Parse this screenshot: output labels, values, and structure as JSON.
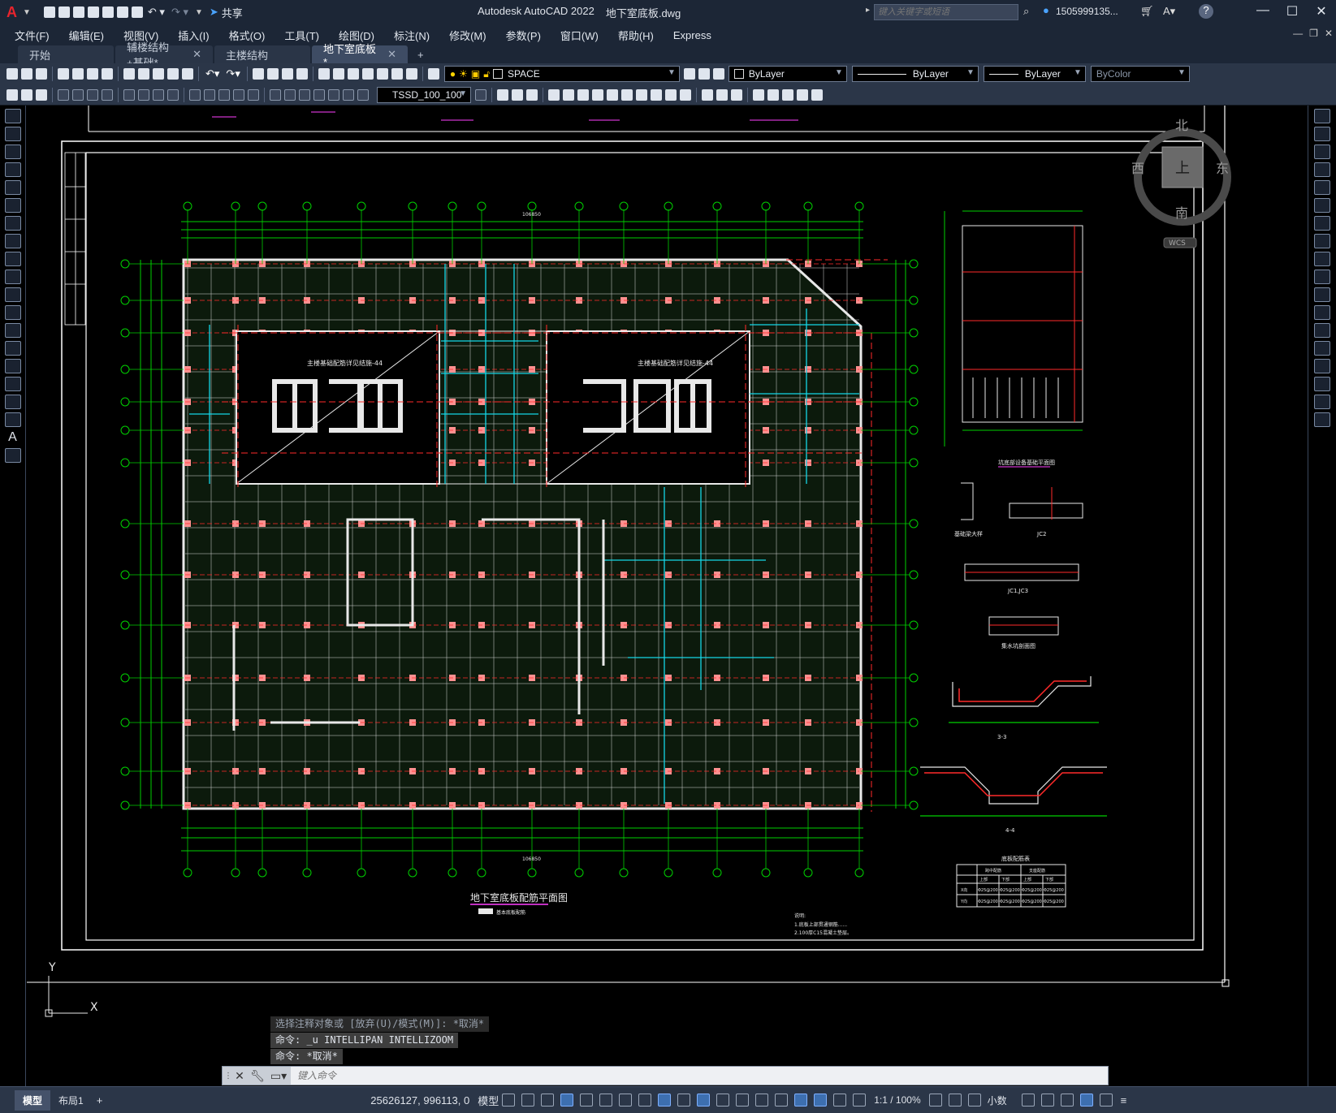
{
  "app": {
    "title": "Autodesk AutoCAD 2022",
    "filename": "地下室底板.dwg",
    "share": "共享",
    "search_placeholder": "键入关键字或短语",
    "user": "1505999135...",
    "logo": "A"
  },
  "menu": [
    "文件(F)",
    "编辑(E)",
    "视图(V)",
    "插入(I)",
    "格式(O)",
    "工具(T)",
    "绘图(D)",
    "标注(N)",
    "修改(M)",
    "参数(P)",
    "窗口(W)",
    "帮助(H)",
    "Express"
  ],
  "tabs": [
    {
      "label": "开始",
      "active": false,
      "closable": false
    },
    {
      "label": "辅楼结构+基础*",
      "active": false,
      "closable": true
    },
    {
      "label": "主楼结构",
      "active": false,
      "closable": false
    },
    {
      "label": "地下室底板*",
      "active": true,
      "closable": true
    }
  ],
  "toolbar": {
    "layer_name": "SPACE",
    "color": "ByLayer",
    "linetype": "ByLayer",
    "lineweight": "ByLayer",
    "plotstyle": "ByColor",
    "textstyle": "TSSD_100_100"
  },
  "drawing": {
    "plan_title": "地下室底板配筋平面图",
    "legend_note": "基本底板配筋",
    "left_core_label": "主楼基础配筋详见结施-44",
    "right_core_label": "主楼基础配筋详见结施-44",
    "detail_titles": [
      "坑底部设备基础平面图",
      "基础梁大样",
      "JC2",
      "JC1,JC3",
      "集水坑剖面图",
      "3-3",
      "4-4",
      "底板配筋表"
    ],
    "notes_title": "说明:",
    "notes": [
      "1.底板上部贯通钢筋......",
      "2.100厚C15混凝土垫层。"
    ],
    "table_headers": [
      "",
      "跨中配筋",
      "支座配筋"
    ],
    "table_subheaders": [
      "上部",
      "下部",
      "上部",
      "下部"
    ],
    "table_rows": [
      [
        "X向",
        "Φ25@200",
        "Φ25@200",
        "Φ25@200",
        "Φ25@200"
      ],
      [
        "Y向",
        "Φ25@200",
        "Φ25@200",
        "Φ25@200",
        "Φ25@200"
      ]
    ],
    "dim_total": "106850"
  },
  "viewcube": {
    "north": "北",
    "south": "南",
    "east": "东",
    "west": "西",
    "top": "上",
    "wcs": "WCS"
  },
  "ucs": {
    "x": "X",
    "y": "Y"
  },
  "commands": {
    "line1": "选择注释对象或 [放弃(U)/模式(M)]: *取消*",
    "line2": "命令: _u INTELLIPAN INTELLIZOOM",
    "line3": "命令: *取消*",
    "input_placeholder": "键入命令"
  },
  "status": {
    "tab_model": "模型",
    "tab_layout": "布局1",
    "coords": "25626127, 996113, 0",
    "mode": "模型",
    "scale": "1:1 / 100%",
    "units": "小数"
  },
  "colors": {
    "grid_green": "#00d000",
    "axis_red": "#ff2a2a",
    "cyan": "#14d7e6",
    "white": "#e8e8e8",
    "magenta": "#ff40ff"
  }
}
